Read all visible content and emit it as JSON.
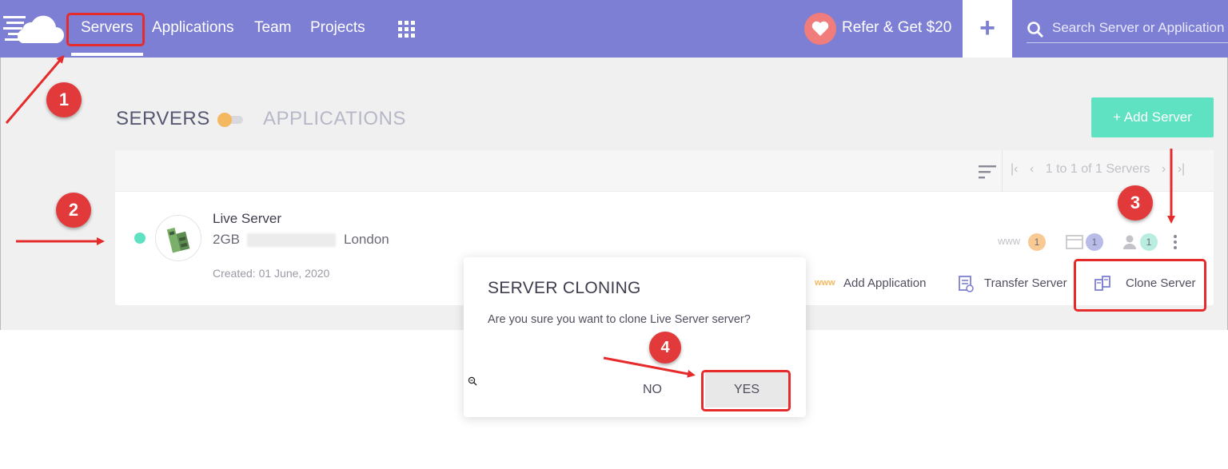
{
  "nav": {
    "items": [
      {
        "label": "Servers",
        "active": true
      },
      {
        "label": "Applications"
      },
      {
        "label": "Team"
      },
      {
        "label": "Projects"
      }
    ],
    "refer_label": "Refer & Get $20",
    "plus_label": "+",
    "search_placeholder": "Search Server or Application"
  },
  "page": {
    "title": "SERVERS",
    "toggle_alt": "APPLICATIONS",
    "add_server_label": "+ Add Server"
  },
  "list": {
    "pagination_text": "1 to 1 of 1 Servers",
    "server": {
      "name": "Live Server",
      "size": "2GB",
      "location": "London",
      "created": "Created: 01 June, 2020",
      "status": "running",
      "stats": [
        {
          "icon": "www-icon",
          "label": "www",
          "count": "1",
          "color": "#f8c993"
        },
        {
          "icon": "files-icon",
          "count": "1",
          "color": "#b9bbe9"
        },
        {
          "icon": "user-icon",
          "count": "1",
          "color": "#b9ede0"
        }
      ]
    },
    "actions": {
      "add_app": "Add Application",
      "transfer": "Transfer Server",
      "clone": "Clone Server"
    }
  },
  "modal": {
    "title": "SERVER CLONING",
    "message": "Are you sure you want to clone Live Server server?",
    "no_label": "NO",
    "yes_label": "YES"
  },
  "annotations": {
    "markers": [
      "1",
      "2",
      "3",
      "4"
    ],
    "color": "#e52b2b"
  },
  "colors": {
    "nav_bg": "#7d7fd4",
    "accent_green": "#5fe2c1",
    "toggle_orange": "#f4b860"
  }
}
